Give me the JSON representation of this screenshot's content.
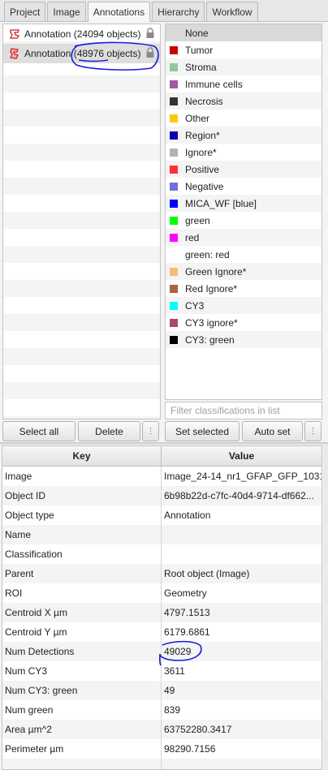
{
  "tabs": [
    {
      "label": "Project"
    },
    {
      "label": "Image"
    },
    {
      "label": "Annotations"
    },
    {
      "label": "Hierarchy"
    },
    {
      "label": "Workflow"
    }
  ],
  "annotations": [
    {
      "name": "Annotation",
      "count": "(24094 objects)"
    },
    {
      "name": "Annotation",
      "count": "(48976 objects)"
    }
  ],
  "classes": [
    {
      "label": "None",
      "color": ""
    },
    {
      "label": "Tumor",
      "color": "#c80000"
    },
    {
      "label": "Stroma",
      "color": "#96c896"
    },
    {
      "label": "Immune cells",
      "color": "#a05aa0"
    },
    {
      "label": "Necrosis",
      "color": "#323232"
    },
    {
      "label": "Other",
      "color": "#ffc800"
    },
    {
      "label": "Region*",
      "color": "#0000b4"
    },
    {
      "label": "Ignore*",
      "color": "#b4b4b4"
    },
    {
      "label": "Positive",
      "color": "#ff3232"
    },
    {
      "label": "Negative",
      "color": "#7070e0"
    },
    {
      "label": "MICA_WF [blue]",
      "color": "#0000ff"
    },
    {
      "label": "green",
      "color": "#00ff00"
    },
    {
      "label": "red",
      "color": "#ff00ff"
    },
    {
      "label": "green: red",
      "color": ""
    },
    {
      "label": "Green Ignore*",
      "color": "#f0c070"
    },
    {
      "label": "Red Ignore*",
      "color": "#a06840"
    },
    {
      "label": "CY3",
      "color": "#00ffff"
    },
    {
      "label": "CY3 ignore*",
      "color": "#a84a6a"
    },
    {
      "label": "CY3: green",
      "color": "#000000"
    }
  ],
  "filter_placeholder": "Filter classifications in list",
  "buttons": {
    "select_all": "Select all",
    "delete": "Delete",
    "more": "⋮",
    "set_selected": "Set selected",
    "auto_set": "Auto set",
    "more2": "⋮"
  },
  "table": {
    "key_header": "Key",
    "value_header": "Value",
    "rows": [
      {
        "key": "Image",
        "value": "Image_24-14_nr1_GFAP_GFP_1031..."
      },
      {
        "key": "Object ID",
        "value": "6b98b22d-c7fc-40d4-9714-df662..."
      },
      {
        "key": "Object type",
        "value": "Annotation"
      },
      {
        "key": "Name",
        "value": ""
      },
      {
        "key": "Classification",
        "value": ""
      },
      {
        "key": "Parent",
        "value": "Root object (Image)"
      },
      {
        "key": "ROI",
        "value": "Geometry"
      },
      {
        "key": "Centroid X µm",
        "value": "4797.1513"
      },
      {
        "key": "Centroid Y µm",
        "value": "6179.6861"
      },
      {
        "key": "Num Detections",
        "value": "49029"
      },
      {
        "key": "Num CY3",
        "value": "3611"
      },
      {
        "key": "Num CY3: green",
        "value": "49"
      },
      {
        "key": "Num green",
        "value": "839"
      },
      {
        "key": "Area µm^2",
        "value": "63752280.3417"
      },
      {
        "key": "Perimeter µm",
        "value": "98290.7156"
      },
      {
        "key": "",
        "value": ""
      }
    ]
  }
}
